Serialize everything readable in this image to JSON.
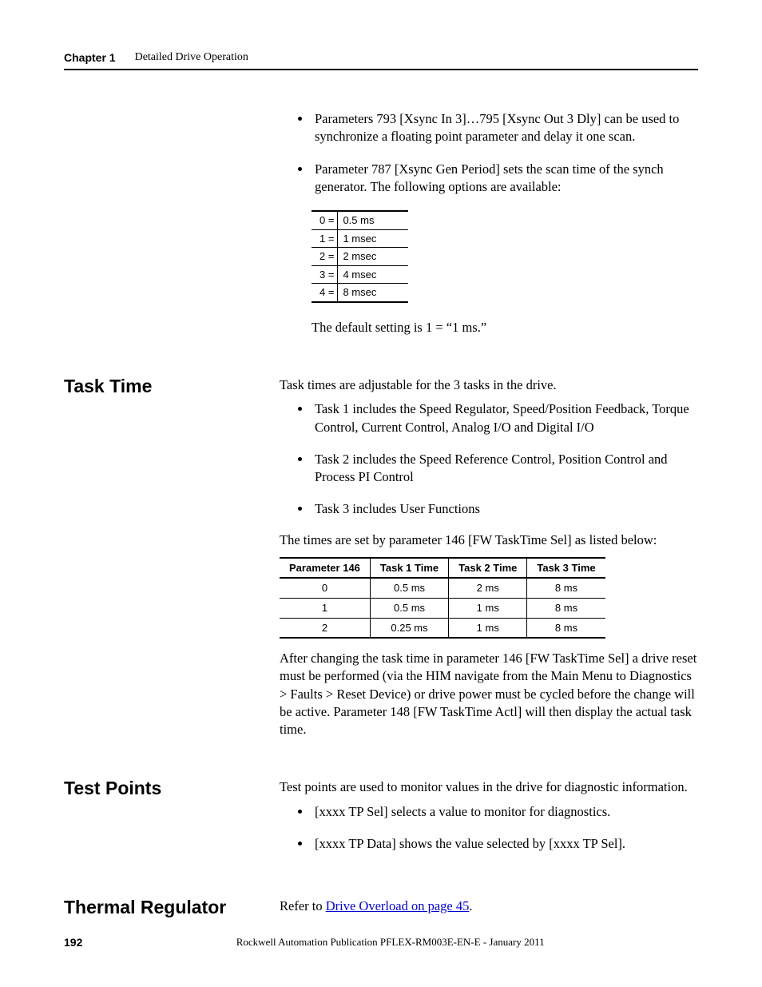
{
  "header": {
    "chapter_label": "Chapter 1",
    "chapter_title": "Detailed Drive Operation"
  },
  "top": {
    "bullets": [
      "Parameters 793 [Xsync In 3]…795 [Xsync Out 3 Dly] can be used to synchronize a floating point parameter and delay it one scan.",
      "Parameter 787 [Xsync Gen Period] sets the scan time of the synch generator. The following options are available:"
    ],
    "options_table": [
      {
        "opt": "0 =",
        "val": "0.5 ms"
      },
      {
        "opt": "1 =",
        "val": "1 msec"
      },
      {
        "opt": "2 =",
        "val": "2 msec"
      },
      {
        "opt": "3 =",
        "val": "4 msec"
      },
      {
        "opt": "4 =",
        "val": "8 msec"
      }
    ],
    "default_note": "The default setting is 1 = “1 ms.”"
  },
  "task_time": {
    "heading": "Task Time",
    "intro": "Task times are adjustable for the 3 tasks in the drive.",
    "bullets": [
      "Task 1 includes the Speed Regulator, Speed/Position Feedback, Torque Control, Current Control, Analog I/O and Digital I/O",
      "Task 2 includes the Speed Reference Control, Position Control and Process PI Control",
      "Task 3 includes User Functions"
    ],
    "table_intro": "The times are set by parameter 146 [FW TaskTime Sel] as listed below:",
    "table": {
      "headers": [
        "Parameter 146",
        "Task 1 Time",
        "Task 2 Time",
        "Task 3 Time"
      ],
      "rows": [
        [
          "0",
          "0.5 ms",
          "2 ms",
          "8 ms"
        ],
        [
          "1",
          "0.5 ms",
          "1 ms",
          "8 ms"
        ],
        [
          "2",
          "0.25 ms",
          "1 ms",
          "8 ms"
        ]
      ]
    },
    "after": "After changing the task time in parameter 146 [FW TaskTime Sel] a drive reset must be performed (via the HIM navigate from the Main Menu to Diagnostics > Faults > Reset Device) or drive power must be cycled before the change will be active. Parameter 148 [FW TaskTime Actl] will then display the actual task time."
  },
  "test_points": {
    "heading": "Test Points",
    "intro": "Test points are used to monitor values in the drive for diagnostic information.",
    "bullets": [
      "[xxxx TP Sel] selects a value to monitor for diagnostics.",
      "[xxxx TP Data] shows the value selected by [xxxx TP Sel]."
    ]
  },
  "thermal": {
    "heading": "Thermal Regulator",
    "text_before_link": "Refer to ",
    "link_text": "Drive Overload on page 45",
    "text_after_link": "."
  },
  "footer": {
    "page": "192",
    "pub": "Rockwell Automation Publication PFLEX-RM003E-EN-E - January 2011"
  }
}
